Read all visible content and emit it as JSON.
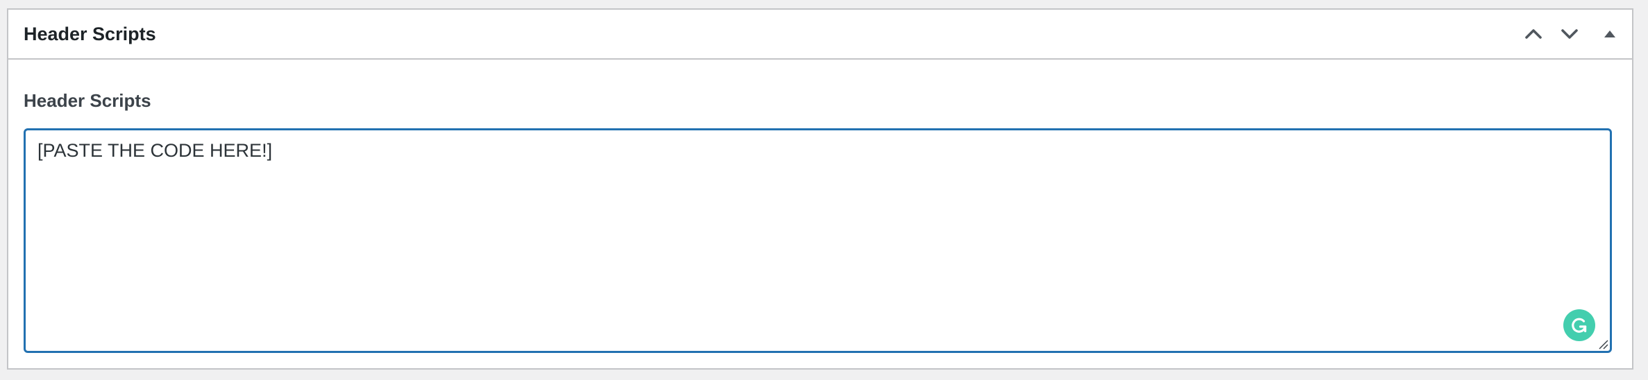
{
  "metabox": {
    "title": "Header Scripts",
    "field_label": "Header Scripts",
    "textarea_value": "[PASTE THE CODE HERE!]",
    "controls": {
      "move_up_icon": "chevron-up-icon",
      "move_down_icon": "chevron-down-icon",
      "toggle_icon": "triangle-up-icon"
    }
  },
  "grammarly": {
    "icon": "grammarly-icon",
    "color": "#15c39a"
  },
  "colors": {
    "focus_border": "#2271b1",
    "page_background": "#f0f0f1",
    "box_border": "#c3c4c7"
  }
}
